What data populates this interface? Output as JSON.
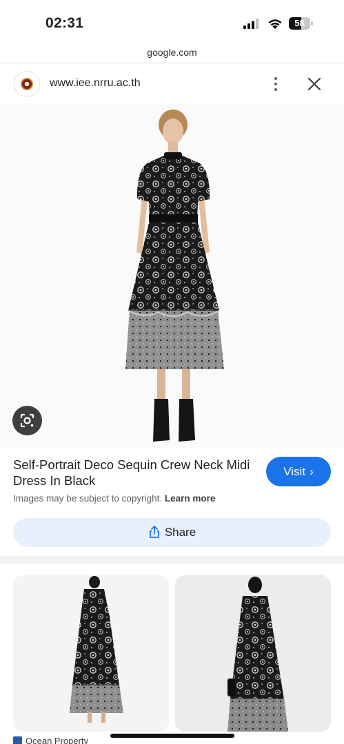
{
  "status_bar": {
    "time": "02:31",
    "battery": "58",
    "battery_level": 0.58
  },
  "browser": {
    "url": "google.com"
  },
  "source": {
    "domain": "www.iee.nrru.ac.th"
  },
  "result": {
    "title": "Self-Portrait Deco Sequin Crew Neck Midi Dress In Black",
    "visit_label": "Visit",
    "copyright_text": "Images may be subject to copyright.",
    "learn_more": "Learn more",
    "share_label": "Share"
  },
  "related": {
    "card_1_source": "Ocean Property"
  },
  "colors": {
    "accent": "#1a73e8",
    "share_bg": "#e9f0fd",
    "dress": "#1b1b1d",
    "lace": "#d9d9dc"
  },
  "icons": [
    "signal-icon",
    "wifi-icon",
    "battery-icon",
    "more-vert-icon",
    "close-icon",
    "lens-icon",
    "chevron-right-icon",
    "share-icon"
  ]
}
